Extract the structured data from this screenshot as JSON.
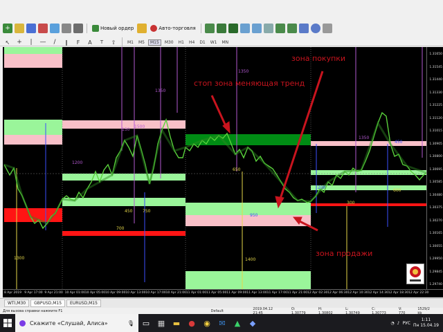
{
  "toolbar": {
    "new_order_label": "Новый ордер",
    "auto_trading_label": "Авто-торговля",
    "timeframes": [
      "M1",
      "M5",
      "M15",
      "M30",
      "H1",
      "H4",
      "D1",
      "W1",
      "MN"
    ]
  },
  "chart": {
    "annotations": {
      "stop_zone": "стоп зона меняющая тренд",
      "buy_zone": "зона покупки",
      "sell_zone": "зона продажи"
    },
    "level_labels": [
      {
        "text": "1300",
        "color": "#e6d84a"
      },
      {
        "text": "1350",
        "color": "#b45ad2"
      },
      {
        "text": "1500",
        "color": "#b45ad2"
      },
      {
        "text": "1200",
        "color": "#b45ad2"
      },
      {
        "text": "150",
        "color": "#b45ad2"
      },
      {
        "text": "700",
        "color": "#e6d84a"
      },
      {
        "text": "450",
        "color": "#e6d84a"
      },
      {
        "text": "750",
        "color": "#e6d84a"
      },
      {
        "text": "1350",
        "color": "#b45ad2"
      },
      {
        "text": "650",
        "color": "#e6d84a"
      },
      {
        "text": "950",
        "color": "#3c50ff"
      },
      {
        "text": "1400",
        "color": "#e6d84a"
      },
      {
        "text": "200",
        "color": "#3c50ff"
      },
      {
        "text": "300",
        "color": "#e6d84a"
      },
      {
        "text": "1350",
        "color": "#b45ad2"
      },
      {
        "text": "450",
        "color": "#3c50ff"
      },
      {
        "text": "600",
        "color": "#e6d84a"
      }
    ],
    "prices": [
      "1.31650",
      "1.31545",
      "1.31440",
      "1.31330",
      "1.31225",
      "1.31120",
      "1.31015",
      "1.30905",
      "1.30800",
      "1.30695",
      "1.30585",
      "1.30480",
      "1.30375",
      "1.30270",
      "1.30165",
      "1.30055",
      "1.29950",
      "1.29845",
      "1.29740"
    ],
    "x_ticks": [
      "8 Apr 2019",
      "9 Apr 17:00",
      "9 Apr 21:00",
      "10 Apr 01:00",
      "10 Apr 05:00",
      "10 Apr 09:00",
      "10 Apr 13:00",
      "10 Apr 17:00",
      "10 Apr 21:00",
      "11 Apr 01:00",
      "11 Apr 05:00",
      "11 Apr 09:00",
      "11 Apr 13:00",
      "11 Apr 17:00",
      "11 Apr 21:00",
      "12 Apr 02:30",
      "12 Apr 06:30",
      "12 Apr 10:30",
      "12 Apr 14:30",
      "12 Apr 18:30",
      "12 Apr 22:30"
    ]
  },
  "tabs": [
    "WTI,M30",
    "GBPUSD,M15",
    "EURUSD,M15"
  ],
  "status": {
    "help": "Для вызова справки нажмите F1",
    "profile": "Default",
    "datetime": "2019.04.12 21:45",
    "open": "O: 1.30779",
    "high": "H: 1.30802",
    "low": "L: 1.30749",
    "close": "C: 1.30773",
    "volume": "V: 770",
    "traffic": "1529/2 kb"
  },
  "taskbar": {
    "search_placeholder": "Скажите «Слушай, Алиса»",
    "lang": "РУС",
    "time": "1:11",
    "date": "Пн 15.04.19"
  },
  "colors": {
    "candle_up": "#5ad23c",
    "zone_green": "#9af59a",
    "zone_pink": "#f8c0c8",
    "zone_red": "#ff1414",
    "zone_dark_green": "#008c14",
    "annotation": "#c8141e"
  }
}
